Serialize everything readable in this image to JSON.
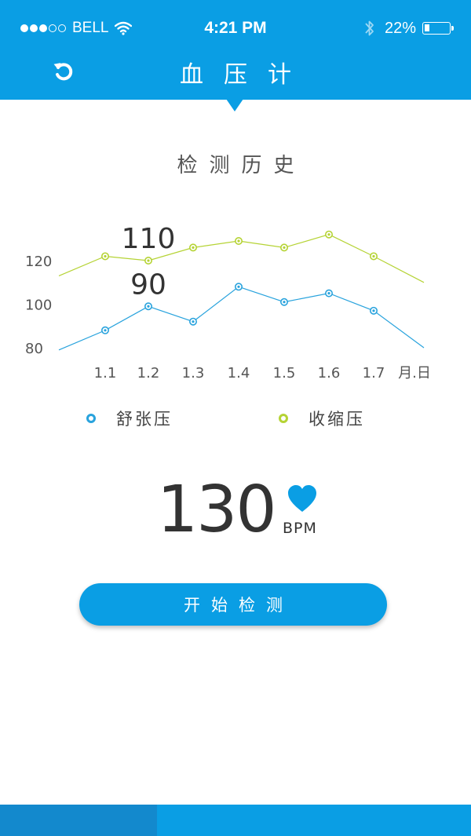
{
  "status_bar": {
    "carrier": "BELL",
    "time": "4:21 PM",
    "battery": "22%",
    "battery_level": 0.22,
    "signal_dots_filled": 3,
    "signal_dots_total": 5
  },
  "header": {
    "title": "血压计",
    "back_icon": "refresh-back-icon",
    "color": "#0a9ee4"
  },
  "section": {
    "title": "检测历史"
  },
  "chart_data": {
    "type": "line",
    "categories": [
      "1.1",
      "1.2",
      "1.3",
      "1.4",
      "1.5",
      "1.6",
      "1.7"
    ],
    "xlabel": "月.日",
    "ylabel": "",
    "yticks": [
      "120",
      "100",
      "80"
    ],
    "series": [
      {
        "name": "舒张压",
        "color": "#29a3dd",
        "values": [
          79,
          88,
          99,
          92,
          108,
          101,
          105,
          97,
          80
        ],
        "note_label": "90",
        "label_index": 2
      },
      {
        "name": "收缩压",
        "color": "#b5d334",
        "values": [
          113,
          122,
          120,
          126,
          129,
          126,
          132,
          122,
          110
        ],
        "note_label": "110",
        "label_index": 2
      }
    ],
    "grid": false,
    "legend": "bottom"
  },
  "legend": {
    "diastolic": "舒张压",
    "systolic": "收缩压"
  },
  "reading": {
    "value": "130",
    "unit": "BPM",
    "icon": "heart-icon",
    "icon_color": "#0a9ee4"
  },
  "actions": {
    "start_label": "开始检测"
  },
  "tabbar": {
    "tabs": 3,
    "active_index": 0
  }
}
